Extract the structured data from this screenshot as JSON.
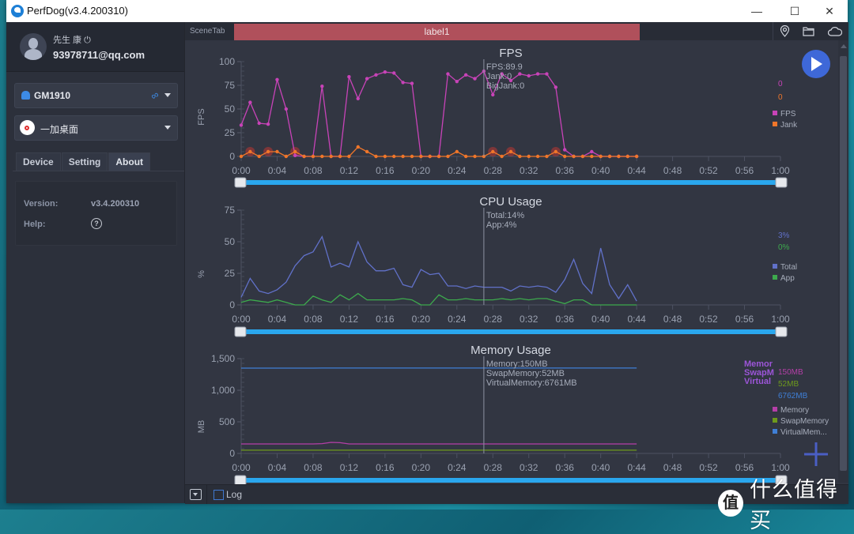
{
  "window": {
    "title": "PerfDog(v3.4.200310)",
    "controls": {
      "minimize": "—",
      "maximize": "☐",
      "close": "✕"
    }
  },
  "sidebar": {
    "user": {
      "name": "先生 康",
      "power_icon": "⏻",
      "email": "93978711@qq.com"
    },
    "device_select": {
      "value": "GM1910",
      "icon": "android-icon",
      "connection_icon": "link-icon"
    },
    "app_select": {
      "value": "一加桌面",
      "icon": "app-icon"
    },
    "tabs": [
      {
        "label": "Device",
        "active": false
      },
      {
        "label": "Setting",
        "active": false
      },
      {
        "label": "About",
        "active": true
      }
    ],
    "about": {
      "version_label": "Version:",
      "version_value": "v3.4.200310",
      "help_label": "Help:",
      "help_icon": "?"
    }
  },
  "main": {
    "scene_tab_label": "SceneTab",
    "active_label": "label1",
    "top_icons": [
      "location-icon",
      "folder-icon",
      "cloud-icon"
    ],
    "play_button": "play-icon",
    "add_button": "+",
    "log_label": "Log",
    "log_checked": false
  },
  "colors": {
    "fps": "#c843b8",
    "jank": "#f0762a",
    "cpu_total": "#6171c9",
    "cpu_app": "#3daa4d",
    "memory": "#b53fa8",
    "swap": "#6e9a1c",
    "virtual": "#3f7fd6",
    "scene_label_bg": "#b0505b",
    "play_button": "#3e68d8",
    "slider": "#2aa7ee"
  },
  "chart_data": [
    {
      "type": "line",
      "title": "FPS",
      "xlabel": "",
      "ylabel": "FPS",
      "xlim": [
        0,
        60
      ],
      "ylim": [
        0,
        100
      ],
      "yticks": [
        0,
        25,
        50,
        75,
        100
      ],
      "xticks": [
        "0:00",
        "0:04",
        "0:08",
        "0:12",
        "0:16",
        "0:20",
        "0:24",
        "0:28",
        "0:32",
        "0:36",
        "0:40",
        "0:44",
        "0:48",
        "0:52",
        "0:56",
        "1:00"
      ],
      "x": [
        0,
        1,
        2,
        3,
        4,
        5,
        6,
        7,
        8,
        9,
        10,
        11,
        12,
        13,
        14,
        15,
        16,
        17,
        18,
        19,
        20,
        21,
        22,
        23,
        24,
        25,
        26,
        27,
        28,
        29,
        30,
        31,
        32,
        33,
        34,
        35,
        36,
        37,
        38,
        39,
        40,
        41,
        42,
        43,
        44
      ],
      "series": [
        {
          "name": "FPS",
          "values": [
            33,
            57,
            35,
            34,
            81,
            50,
            1,
            0,
            0,
            74,
            0,
            0,
            84,
            61,
            82,
            86,
            89,
            88,
            78,
            77,
            0,
            0,
            0,
            87,
            79,
            86,
            82,
            89.9,
            65,
            87,
            80,
            87,
            85,
            87,
            87,
            73,
            7,
            0,
            0,
            5,
            0,
            0,
            0,
            0,
            0
          ]
        },
        {
          "name": "Jank",
          "values": [
            0,
            5,
            0,
            5,
            5,
            0,
            5,
            0,
            0,
            0,
            0,
            0,
            0,
            10,
            5,
            0,
            0,
            0,
            0,
            0,
            0,
            0,
            0,
            0,
            5,
            0,
            0,
            0,
            5,
            0,
            5,
            0,
            0,
            0,
            0,
            5,
            0,
            0,
            0,
            0,
            0,
            0,
            0,
            0,
            0
          ]
        }
      ],
      "jank_markers_x": [
        1,
        3,
        6,
        28,
        30,
        35
      ],
      "cursor": {
        "x": 27,
        "lines": [
          "FPS:89.9",
          "Jank:0",
          "BigJank:0"
        ]
      },
      "legend": [
        {
          "name": "FPS",
          "current": "0"
        },
        {
          "name": "Jank",
          "current": "0"
        }
      ],
      "legend_position": "right"
    },
    {
      "type": "line",
      "title": "CPU Usage",
      "xlabel": "",
      "ylabel": "%",
      "xlim": [
        0,
        60
      ],
      "ylim": [
        0,
        75
      ],
      "yticks": [
        0,
        25,
        50,
        75
      ],
      "xticks": [
        "0:00",
        "0:04",
        "0:08",
        "0:12",
        "0:16",
        "0:20",
        "0:24",
        "0:28",
        "0:32",
        "0:36",
        "0:40",
        "0:44",
        "0:48",
        "0:52",
        "0:56",
        "1:00"
      ],
      "x": [
        0,
        1,
        2,
        3,
        4,
        5,
        6,
        7,
        8,
        9,
        10,
        11,
        12,
        13,
        14,
        15,
        16,
        17,
        18,
        19,
        20,
        21,
        22,
        23,
        24,
        25,
        26,
        27,
        28,
        29,
        30,
        31,
        32,
        33,
        34,
        35,
        36,
        37,
        38,
        39,
        40,
        41,
        42,
        43,
        44
      ],
      "series": [
        {
          "name": "Total",
          "values": [
            6,
            21,
            11,
            9,
            12,
            18,
            31,
            39,
            42,
            54,
            30,
            33,
            30,
            50,
            34,
            27,
            27,
            29,
            16,
            14,
            28,
            24,
            25,
            15,
            15,
            13,
            15,
            14,
            14,
            14,
            11,
            15,
            14,
            15,
            14,
            10,
            20,
            36,
            17,
            9,
            45,
            16,
            5,
            16,
            3
          ]
        },
        {
          "name": "App",
          "values": [
            2,
            4,
            3,
            2,
            4,
            2,
            0,
            0,
            7,
            4,
            2,
            8,
            4,
            9,
            4,
            4,
            4,
            4,
            5,
            4,
            0,
            0,
            8,
            4,
            4,
            5,
            4,
            4,
            4,
            5,
            4,
            5,
            4,
            5,
            5,
            3,
            1,
            4,
            4,
            0,
            0,
            0,
            0,
            0,
            0
          ]
        }
      ],
      "cursor": {
        "x": 27,
        "lines": [
          "Total:14%",
          "App:4%"
        ]
      },
      "legend": [
        {
          "name": "Total",
          "current": "3%"
        },
        {
          "name": "App",
          "current": "0%"
        }
      ],
      "legend_position": "right"
    },
    {
      "type": "line",
      "title": "Memory Usage",
      "xlabel": "",
      "ylabel": "MB",
      "xlim": [
        0,
        60
      ],
      "ylim": [
        0,
        1500
      ],
      "yticks": [
        0,
        500,
        1000,
        1500
      ],
      "ytick_labels": [
        "0",
        "500",
        "1,000",
        "1,500"
      ],
      "xticks": [
        "0:00",
        "0:04",
        "0:08",
        "0:12",
        "0:16",
        "0:20",
        "0:24",
        "0:28",
        "0:32",
        "0:36",
        "0:40",
        "0:44",
        "0:48",
        "0:52",
        "0:56",
        "1:00"
      ],
      "x": [
        0,
        4,
        8,
        9,
        10,
        11,
        12,
        16,
        20,
        24,
        28,
        32,
        36,
        40,
        44
      ],
      "series": [
        {
          "name": "Memory",
          "values": [
            150,
            150,
            150,
            155,
            175,
            170,
            150,
            150,
            150,
            150,
            150,
            150,
            150,
            150,
            150
          ]
        },
        {
          "name": "SwapMemory",
          "values": [
            52,
            52,
            52,
            52,
            52,
            52,
            52,
            52,
            52,
            52,
            52,
            52,
            52,
            52,
            52
          ]
        },
        {
          "name": "VirtualMemory",
          "values": [
            1350,
            1350,
            1350,
            1352,
            1352,
            1352,
            1352,
            1352,
            1352,
            1352,
            1352,
            1352,
            1352,
            1352,
            1352
          ]
        }
      ],
      "cursor": {
        "x": 27,
        "lines": [
          "Memory:150MB",
          "SwapMemory:52MB",
          "VirtualMemory:6761MB"
        ]
      },
      "legend_truncated_labels": [
        "Memor",
        "SwapM",
        "Virtual"
      ],
      "legend": [
        {
          "name": "Memory",
          "current": "150MB"
        },
        {
          "name": "SwapMemory",
          "current": "52MB"
        },
        {
          "name": "VirtualMem...",
          "current": "6762MB"
        }
      ],
      "legend_position": "right"
    }
  ],
  "watermark": {
    "badge": "值",
    "text": "什么值得买"
  }
}
